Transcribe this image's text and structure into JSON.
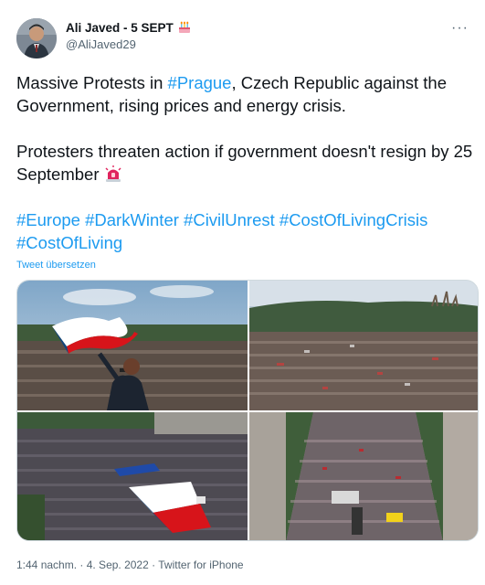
{
  "author": {
    "display_name": "Ali Javed - 5 SEPT",
    "handle": "@AliJaved29",
    "avatar_icon": "profile-photo"
  },
  "badges": {
    "birthday_icon": "birthday-cake-icon",
    "more_icon": "more-options-icon"
  },
  "more_label": "···",
  "tweet": {
    "line1_pre": "Massive Protests in ",
    "line1_tag": "#Prague",
    "line1_post": ", Czech Republic against the Government, rising prices and energy crisis.",
    "line2": "Protesters threaten action if government doesn't resign by 25 September",
    "hashtags": [
      "#Europe",
      "#DarkWinter",
      "#CivilUnrest",
      "#CostOfLivingCrisis",
      "#CostOfLiving"
    ],
    "emoji_icon": "police-light-icon"
  },
  "translate_label": "Tweet übersetzen",
  "footer": {
    "time": "1:44 nachm.",
    "date": "4. Sep. 2022",
    "sep": " · ",
    "source": "Twitter for iPhone"
  },
  "colors": {
    "link": "#1d9bf0",
    "text": "#0f1419",
    "muted": "#536471",
    "border": "#cfd9de"
  }
}
